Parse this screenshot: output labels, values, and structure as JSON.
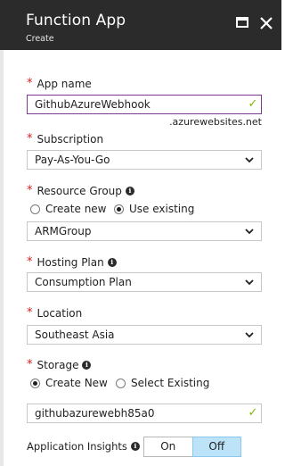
{
  "header": {
    "title": "Function App",
    "subtitle": "Create"
  },
  "app_name": {
    "label": "App name",
    "value": "GithubAzureWebhook",
    "suffix": ".azurewebsites.net"
  },
  "subscription": {
    "label": "Subscription",
    "value": "Pay-As-You-Go"
  },
  "resource_group": {
    "label": "Resource Group",
    "options": [
      "Create new",
      "Use existing"
    ],
    "selected": "Use existing",
    "value": "ARMGroup"
  },
  "hosting_plan": {
    "label": "Hosting Plan",
    "value": "Consumption Plan"
  },
  "location": {
    "label": "Location",
    "value": "Southeast Asia"
  },
  "storage": {
    "label": "Storage",
    "options": [
      "Create New",
      "Select Existing"
    ],
    "selected": "Create New",
    "value": "githubazurewebh85a0"
  },
  "app_insights": {
    "label": "Application Insights",
    "options": [
      "On",
      "Off"
    ],
    "selected": "Off"
  },
  "colors": {
    "header_bg": "#2b2b2b",
    "required": "#d21f1f",
    "valid_check": "#7fba00",
    "active_border": "#7a3c8c",
    "toggle_selected": "#bde3f9"
  },
  "icons": {
    "maximize": "maximize-icon",
    "close": "close-icon",
    "info": "info-icon",
    "check": "check-icon",
    "chevron": "chevron-down-icon"
  }
}
